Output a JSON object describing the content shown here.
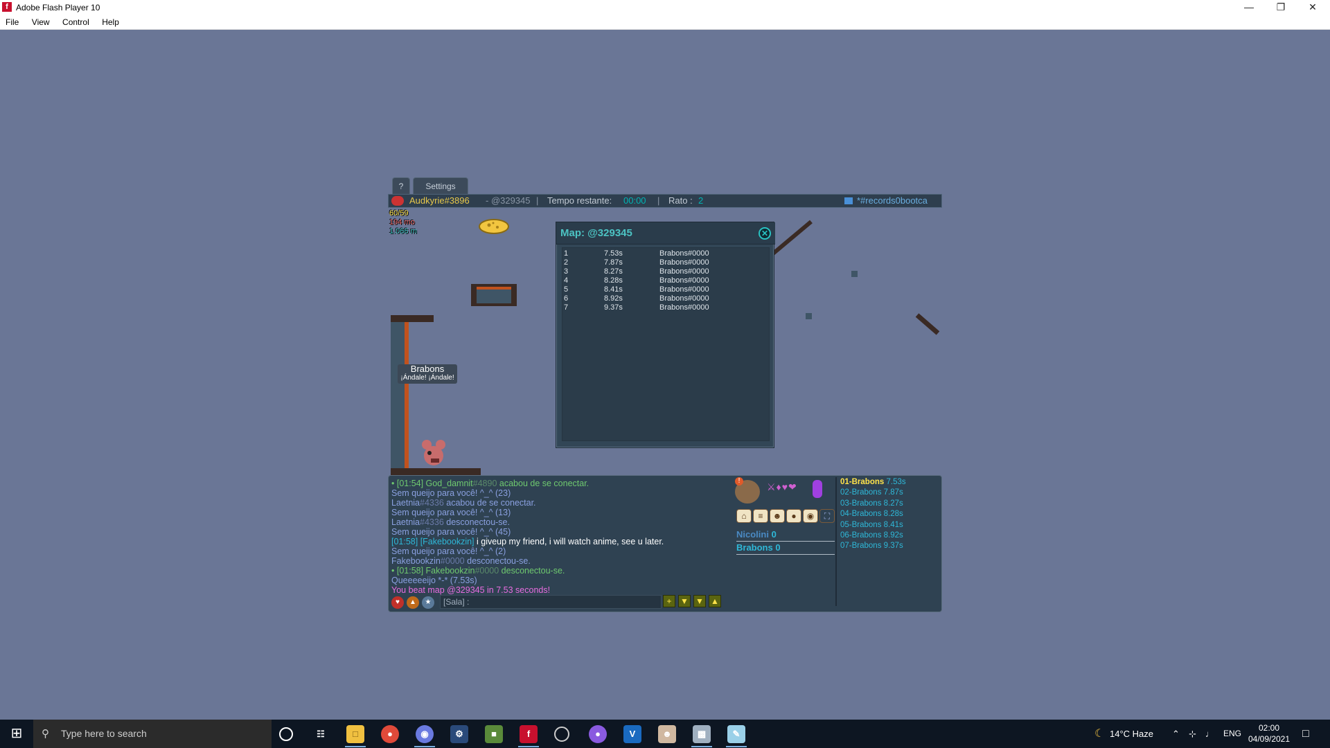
{
  "window": {
    "title": "Adobe Flash Player 10",
    "menu": [
      "File",
      "View",
      "Control",
      "Help"
    ]
  },
  "game": {
    "tabs": [
      "?",
      "Settings"
    ],
    "hud": {
      "player": "Audkyrie#3896",
      "map_code": "- @329345",
      "time_label": "Tempo restante:",
      "time_value": "00:00",
      "rato_label": "Rato :",
      "rato_value": "2",
      "room": "*#records0bootca"
    },
    "stats": {
      "cheese": "60/59",
      "mo": "194 mo",
      "m": "1.066 m"
    },
    "map_popup": {
      "title": "Map: @329345",
      "close": "✕",
      "rows": [
        {
          "rank": "1",
          "time": "7.53s",
          "player": "Brabons#0000"
        },
        {
          "rank": "2",
          "time": "7.87s",
          "player": "Brabons#0000"
        },
        {
          "rank": "3",
          "time": "8.27s",
          "player": "Brabons#0000"
        },
        {
          "rank": "4",
          "time": "8.28s",
          "player": "Brabons#0000"
        },
        {
          "rank": "5",
          "time": "8.41s",
          "player": "Brabons#0000"
        },
        {
          "rank": "6",
          "time": "8.92s",
          "player": "Brabons#0000"
        },
        {
          "rank": "7",
          "time": "9.37s",
          "player": "Brabons#0000"
        }
      ]
    },
    "mouse": {
      "name": "Brabons",
      "title": "¡Ándale! ¡Ándale!"
    },
    "chat": [
      {
        "parts": [
          {
            "t": "• [01:54] God_damnit",
            "c": "#6fc96f"
          },
          {
            "t": "#4890",
            "c": "#5a8a6a"
          },
          {
            "t": " acabou de se conectar.",
            "c": "#6fc96f"
          }
        ]
      },
      {
        "parts": [
          {
            "t": "Sem queijo para você! ^_^ (23)",
            "c": "#8aa0e0"
          }
        ]
      },
      {
        "parts": [
          {
            "t": "Laetnia",
            "c": "#8aa0e0"
          },
          {
            "t": "#4336",
            "c": "#6a7aa8"
          },
          {
            "t": " acabou de se conectar.",
            "c": "#8aa0e0"
          }
        ]
      },
      {
        "parts": [
          {
            "t": "Sem queijo para você! ^_^ (13)",
            "c": "#8aa0e0"
          }
        ]
      },
      {
        "parts": [
          {
            "t": "Laetnia",
            "c": "#8aa0e0"
          },
          {
            "t": "#4336",
            "c": "#6a7aa8"
          },
          {
            "t": " desconectou-se.",
            "c": "#8aa0e0"
          }
        ]
      },
      {
        "parts": [
          {
            "t": "Sem queijo para você! ^_^ (45)",
            "c": "#8aa0e0"
          }
        ]
      },
      {
        "parts": [
          {
            "t": "[01:58] [Fakebookzin]",
            "c": "#2fb8d8"
          },
          {
            "t": " i giveup my friend, i will watch anime, see u later.",
            "c": "#ffffff"
          }
        ]
      },
      {
        "parts": [
          {
            "t": "Sem queijo para você! ^_^ (2)",
            "c": "#8aa0e0"
          }
        ]
      },
      {
        "parts": [
          {
            "t": "Fakebookzin",
            "c": "#8aa0e0"
          },
          {
            "t": "#0000",
            "c": "#6a7aa8"
          },
          {
            "t": " desconectou-se.",
            "c": "#8aa0e0"
          }
        ]
      },
      {
        "parts": [
          {
            "t": "• [01:58] Fakebookzin",
            "c": "#6fc96f"
          },
          {
            "t": "#0000",
            "c": "#5a8a6a"
          },
          {
            "t": " desconectou-se.",
            "c": "#6fc96f"
          }
        ]
      },
      {
        "parts": [
          {
            "t": "Queeeeeijo *-* (7.53s)",
            "c": "#8aa0e0"
          }
        ]
      },
      {
        "parts": [
          {
            "t": "You beat map @329345 in 7.53 seconds!",
            "c": "#e86ce0"
          }
        ]
      }
    ],
    "chat_input": {
      "placeholder": "[Sala] :"
    },
    "players": [
      {
        "name": "Nicolini",
        "score": "0",
        "color": "#4a8ac4"
      },
      {
        "name": "Brabons",
        "score": "0",
        "color": "#2fb8d8"
      }
    ],
    "ranking": [
      {
        "label": "01-Brabons",
        "time": "7.53s",
        "color": "#ffe34a"
      },
      {
        "label": "02-Brabons",
        "time": "7.87s",
        "color": "#2fb8d8"
      },
      {
        "label": "03-Brabons",
        "time": "8.27s",
        "color": "#2fb8d8"
      },
      {
        "label": "04-Brabons",
        "time": "8.28s",
        "color": "#2fb8d8"
      },
      {
        "label": "05-Brabons",
        "time": "8.41s",
        "color": "#2fb8d8"
      },
      {
        "label": "06-Brabons",
        "time": "8.92s",
        "color": "#2fb8d8"
      },
      {
        "label": "07-Brabons",
        "time": "9.37s",
        "color": "#2fb8d8"
      }
    ]
  },
  "taskbar": {
    "search_placeholder": "Type here to search",
    "weather": "14°C  Haze",
    "lang": "ENG",
    "time": "02:00",
    "date": "04/09/2021"
  }
}
